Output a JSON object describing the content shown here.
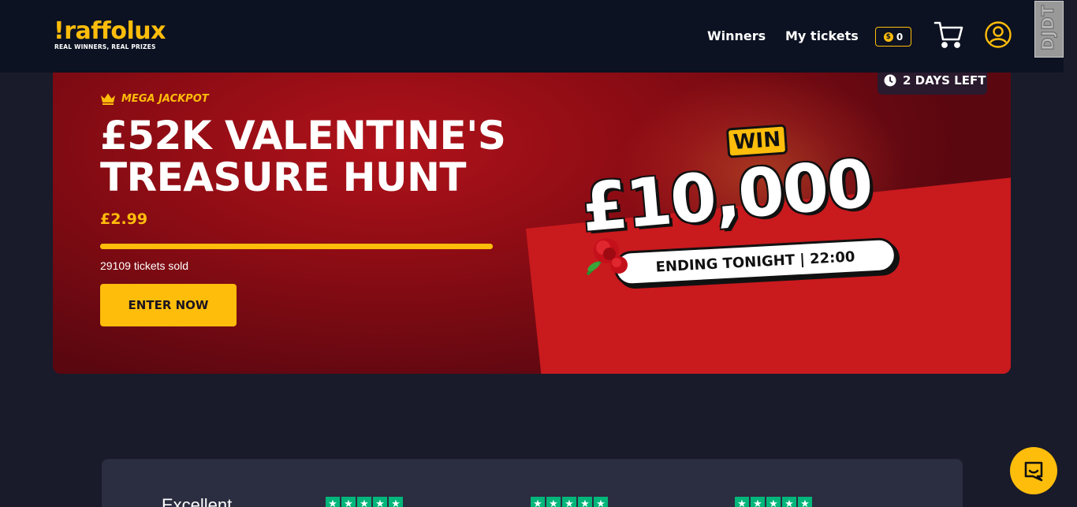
{
  "header": {
    "logo_text": "raffolux",
    "logo_tagline": "REAL WINNERS, REAL PRIZES",
    "nav": [
      {
        "label": "Winners"
      },
      {
        "label": "My tickets"
      }
    ],
    "coin_balance": "0",
    "debug_toolbar_label": "DJDT"
  },
  "hero": {
    "time_left": "2 DAYS LEFT",
    "category": "MEGA JACKPOT",
    "title": "£52K VALENTINE'S TREASURE HUNT",
    "price": "£2.99",
    "tickets_sold_text": "29109 tickets sold",
    "progress_fraction": 1.0,
    "cta_label": "ENTER NOW",
    "prize_win_label": "WIN",
    "prize_amount": "£10,000",
    "prize_ending": "ENDING TONIGHT | 22:00"
  },
  "trust": {
    "rating_word": "Excellent",
    "star_groups": [
      5,
      5,
      5
    ]
  },
  "colors": {
    "accent": "#ffbd0b",
    "header_bg": "#0c1221",
    "page_bg": "#191b2a",
    "hero_red": "#b0121a",
    "trustpilot_green": "#00b67a"
  },
  "icons": {
    "logo": "raffolux-logo",
    "coin": "coin-icon",
    "cart": "cart-icon",
    "user": "user-icon",
    "clock": "clock-icon",
    "crown": "crown-icon",
    "rose": "rose-icon",
    "star": "star-icon",
    "chat": "chat-icon"
  }
}
